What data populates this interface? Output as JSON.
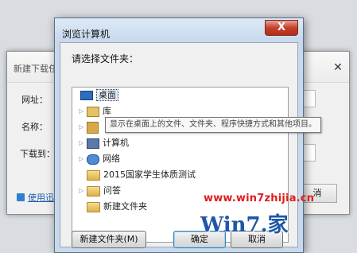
{
  "background_dialog": {
    "title": "新建下载任",
    "url_label": "网址：",
    "name_label": "名称：",
    "save_to_label": "下载到：",
    "link_text": "使用迅",
    "cancel_label": "消"
  },
  "browse_dialog": {
    "title": "浏览计算机",
    "close_label": "X",
    "prompt": "请选择文件夹：",
    "tree_items": [
      {
        "label": "桌面",
        "icon": "desktop-icon",
        "expandable": false,
        "selected": true
      },
      {
        "label": "库",
        "icon": "library-icon",
        "expandable": true,
        "selected": false
      },
      {
        "label": "",
        "icon": "user-folder-icon",
        "expandable": true,
        "selected": false
      },
      {
        "label": "计算机",
        "icon": "computer-icon",
        "expandable": true,
        "selected": false
      },
      {
        "label": "网络",
        "icon": "network-icon",
        "expandable": true,
        "selected": false
      },
      {
        "label": "2015国家学生体质测试",
        "icon": "folder-icon",
        "expandable": false,
        "selected": false
      },
      {
        "label": "问答",
        "icon": "folder-icon",
        "expandable": true,
        "selected": false
      },
      {
        "label": "新建文件夹",
        "icon": "folder-icon",
        "expandable": false,
        "selected": false
      }
    ],
    "tooltip": "显示在桌面上的文件、文件夹、程序快捷方式和其他项目。",
    "buttons": {
      "new_folder": "新建文件夹(M)",
      "ok": "确定",
      "cancel": "取消"
    }
  },
  "watermark": {
    "url": "www.win7zhijia.cn",
    "logo": "Win7.家"
  }
}
